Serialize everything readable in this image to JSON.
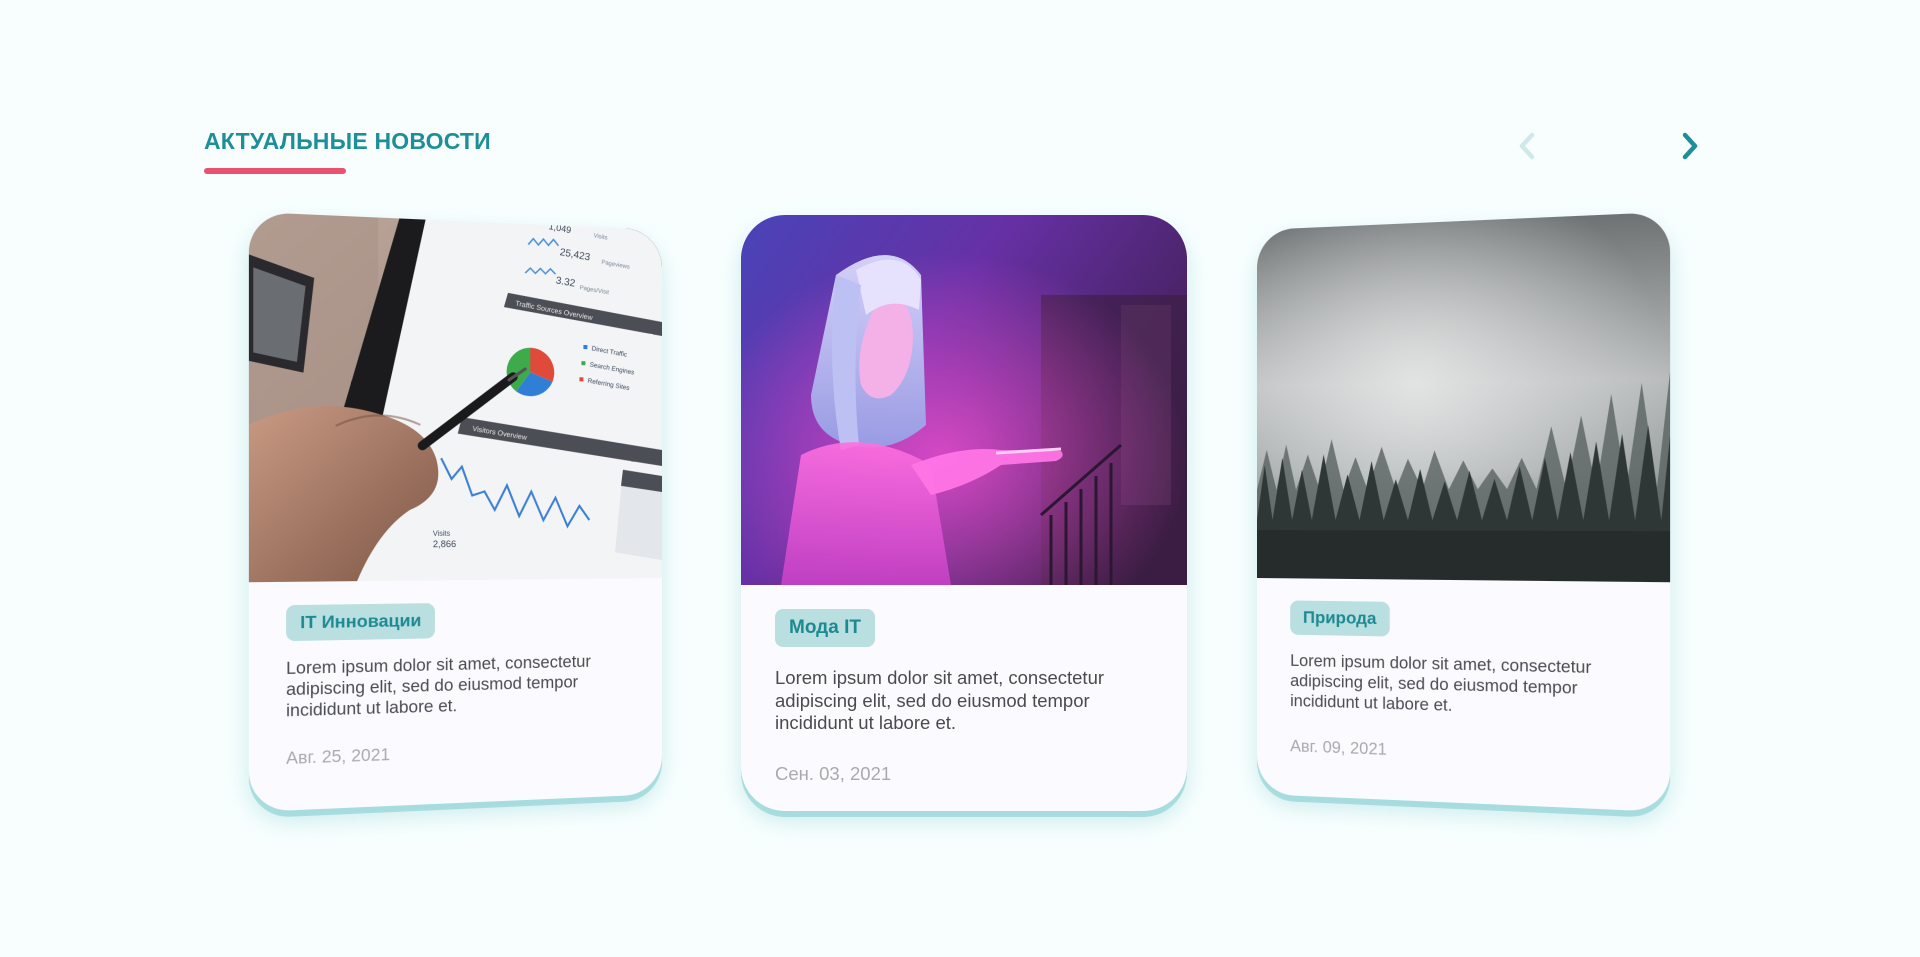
{
  "header": {
    "title": "АКТУАЛЬНЫЕ НОВОСТИ",
    "underline_color": "#e9526f",
    "title_color": "#1e8e98"
  },
  "nav": {
    "prev_icon": "chevron-left-icon",
    "next_icon": "chevron-right-icon",
    "prev_enabled": false,
    "next_enabled": true
  },
  "cards": [
    {
      "image": "tablet-analytics-photo",
      "tag": "IT Инновации",
      "text": "Lorem ipsum dolor sit amet, consectetur adipiscing elit, sed do eiusmod tempor incididunt ut labore et.",
      "date": "Авг. 25, 2021",
      "image_labels": {
        "visits_top": "1,049",
        "visits_top_suffix": "Visits",
        "pageviews": "25,423",
        "pageviews_suffix": "Pageviews",
        "pages_per_visit": "3.32",
        "pages_per_visit_suffix": "Pages/Visit",
        "traffic_title": "Traffic Sources Overview",
        "legend": [
          "Direct Traffic",
          "Search Engines",
          "Referring Sites"
        ],
        "visitors_title": "Visitors Overview",
        "visits_label": "Visits",
        "visits_value": "2,866"
      }
    },
    {
      "image": "neon-hologram-photo",
      "tag": "Мода IT",
      "text": "Lorem ipsum dolor sit amet, consectetur adipiscing elit, sed do eiusmod tempor incididunt ut labore et.",
      "date": "Сен. 03, 2021"
    },
    {
      "image": "misty-forest-photo",
      "tag": "Природа",
      "text": "Lorem ipsum dolor sit amet, consectetur adipiscing elit, sed do eiusmod tempor incididunt ut labore et.",
      "date": "Авг. 09, 2021"
    }
  ],
  "colors": {
    "page_background": "#f8fefe",
    "card_background": "#fbfaff",
    "tag_background": "#b9dfe0",
    "tag_text": "#1d8a92",
    "card_shadow": "#96d6d8",
    "date_text": "#a9a9b0"
  }
}
